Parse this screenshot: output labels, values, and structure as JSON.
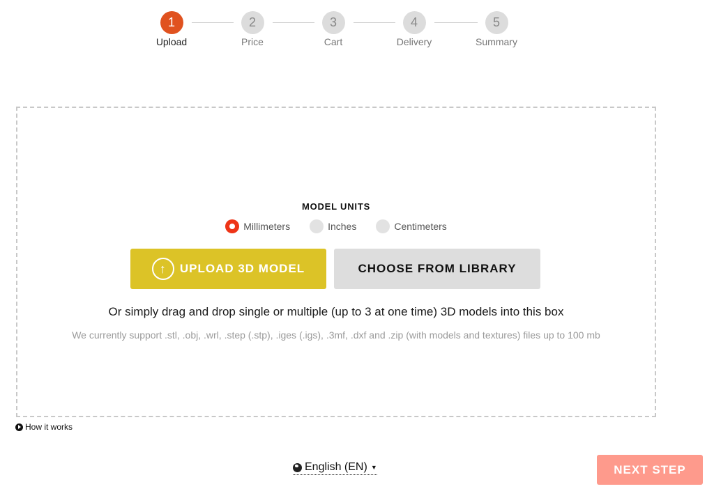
{
  "stepper": {
    "steps": [
      {
        "number": "1",
        "label": "Upload",
        "active": true
      },
      {
        "number": "2",
        "label": "Price",
        "active": false
      },
      {
        "number": "3",
        "label": "Cart",
        "active": false
      },
      {
        "number": "4",
        "label": "Delivery",
        "active": false
      },
      {
        "number": "5",
        "label": "Summary",
        "active": false
      }
    ]
  },
  "upload": {
    "units_title": "MODEL UNITS",
    "units": [
      {
        "label": "Millimeters",
        "checked": true
      },
      {
        "label": "Inches",
        "checked": false
      },
      {
        "label": "Centimeters",
        "checked": false
      }
    ],
    "upload_button": "UPLOAD 3D MODEL",
    "upload_icon": "↑",
    "library_button": "CHOOSE FROM LIBRARY",
    "drag_text": "Or simply drag and drop single or multiple (up to 3 at one time) 3D models into this box",
    "support_text": "We currently support .stl, .obj, .wrl, .step (.stp), .iges (.igs), .3mf, .dxf and .zip (with models and textures) files up to 100 mb"
  },
  "footer": {
    "how_it_works": "How it works",
    "language": "English (EN)",
    "caret": "▼",
    "next_step": "NEXT STEP"
  },
  "colors": {
    "active_step": "#e0521f",
    "upload_button": "#dcc327",
    "radio_checked": "#ee3417",
    "next_step": "#fe9a8c"
  }
}
